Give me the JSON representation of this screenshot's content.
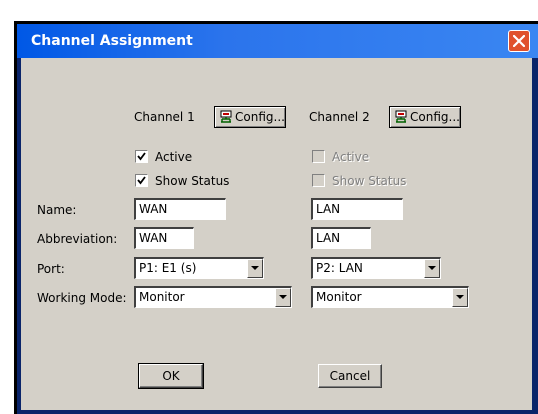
{
  "window": {
    "title": "Channel Assignment"
  },
  "channel1": {
    "heading": "Channel 1",
    "config_label": "Config...",
    "active_label": "Active",
    "active_checked": true,
    "show_status_label": "Show Status",
    "show_status_checked": true,
    "name": "WAN",
    "abbreviation": "WAN",
    "port": "P1: E1 (s)",
    "working_mode": "Monitor"
  },
  "channel2": {
    "heading": "Channel 2",
    "config_label": "Config...",
    "active_label": "Active",
    "active_checked": false,
    "show_status_label": "Show Status",
    "show_status_checked": false,
    "name": "LAN",
    "abbreviation": "LAN",
    "port": "P2: LAN",
    "working_mode": "Monitor"
  },
  "labels": {
    "name": "Name:",
    "abbreviation": "Abbreviation:",
    "port": "Port:",
    "working_mode": "Working Mode:"
  },
  "buttons": {
    "ok": "OK",
    "cancel": "Cancel"
  },
  "icons": {
    "close": "close-icon",
    "config": "network-config-icon",
    "dropdown": "dropdown-arrow-icon"
  },
  "colors": {
    "titlebar": "#0058e6",
    "close": "#e0512c",
    "face": "#d4d0c8"
  }
}
